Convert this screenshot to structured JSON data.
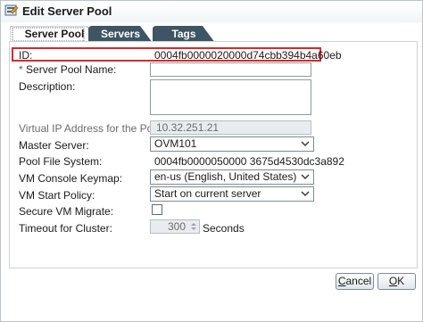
{
  "dialog": {
    "title": "Edit Server Pool"
  },
  "tabs": [
    {
      "label": "Server Pool",
      "active": true
    },
    {
      "label": "Servers",
      "active": false
    },
    {
      "label": "Tags",
      "active": false
    }
  ],
  "form": {
    "id_label": "ID:",
    "id_value": "0004fb0000020000d74cbb394b4a60eb",
    "name_required_mark": "*",
    "name_label": "Server Pool Name:",
    "name_value": "",
    "description_label": "Description:",
    "description_value": "",
    "vip_label": "Virtual IP Address for the Pool:",
    "vip_value": "10.32.251.21",
    "master_label": "Master Server:",
    "master_value": "OVM101",
    "pfs_label": "Pool File System:",
    "pfs_value": "0004fb0000050000 3675d4530dc3a892",
    "keymap_label": "VM Console Keymap:",
    "keymap_value": "en-us (English, United States)",
    "startpolicy_label": "VM Start Policy:",
    "startpolicy_value": "Start on current server",
    "secure_label": "Secure VM Migrate:",
    "secure_checked": false,
    "timeout_label": "Timeout for Cluster:",
    "timeout_value": "300",
    "timeout_unit": "Seconds"
  },
  "buttons": {
    "cancel": "Cancel",
    "ok": "OK"
  },
  "colors": {
    "tab_active": "#ffffff",
    "tab_inactive": "#3e5563",
    "highlight_border": "#d8282b"
  }
}
